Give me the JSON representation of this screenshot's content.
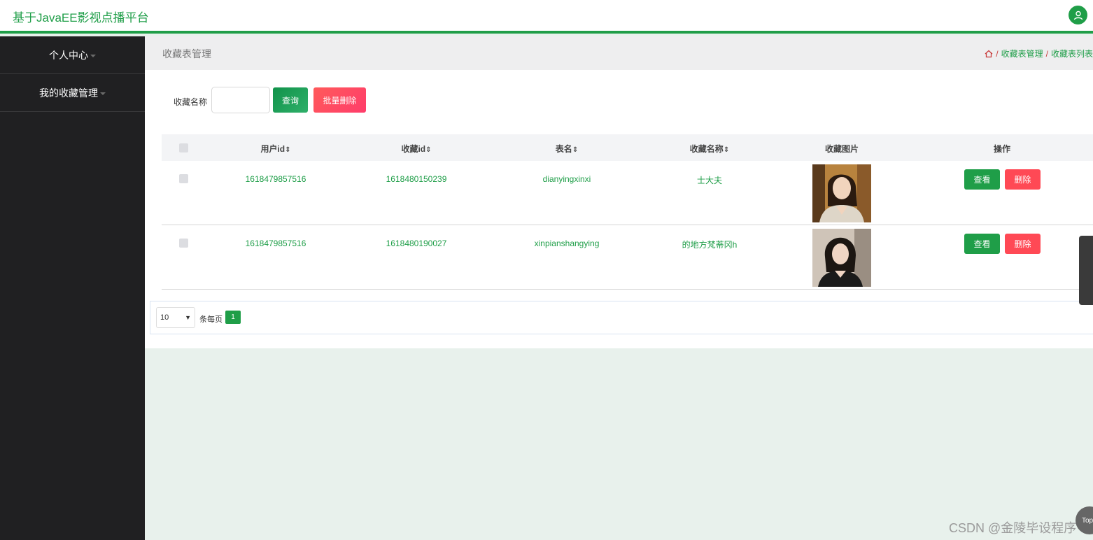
{
  "header": {
    "title": "基于JavaEE影视点播平台",
    "user_icon": "user-icon",
    "cursor_icon": "cursor-arrow-icon"
  },
  "sidebar": {
    "items": [
      {
        "label": "个人中心"
      },
      {
        "label": "我的收藏管理"
      }
    ]
  },
  "breadcrumb": {
    "page_title": "收藏表管理",
    "home_icon": "home-icon",
    "separator": "/",
    "level1": "收藏表管理",
    "level2": "收藏表列表"
  },
  "search": {
    "label": "收藏名称",
    "value": "",
    "placeholder": "",
    "query_label": "查询",
    "batch_delete_label": "批量删除"
  },
  "table": {
    "columns": [
      "用户id",
      "收藏id",
      "表名",
      "收藏名称",
      "收藏图片",
      "操作"
    ],
    "sort_icon": "⇕",
    "rows": [
      {
        "user_id": "1618479857516",
        "fav_id": "1618480150239",
        "table_name": "dianyingxinxi",
        "fav_name": "士大夫",
        "view_label": "查看",
        "delete_label": "删除"
      },
      {
        "user_id": "1618479857516",
        "fav_id": "1618480190027",
        "table_name": "xinpianshangying",
        "fav_name": "的地方梵蒂冈h",
        "view_label": "查看",
        "delete_label": "删除"
      }
    ]
  },
  "pagination": {
    "page_size": "10",
    "per_page_label": "条每页",
    "current_page": "1"
  },
  "widgets": {
    "top_label": "Top"
  },
  "watermark": "CSDN @金陵毕设程序",
  "colors": {
    "accent": "#1f9e48",
    "danger": "#ff4955",
    "sidebar": "#202022"
  }
}
